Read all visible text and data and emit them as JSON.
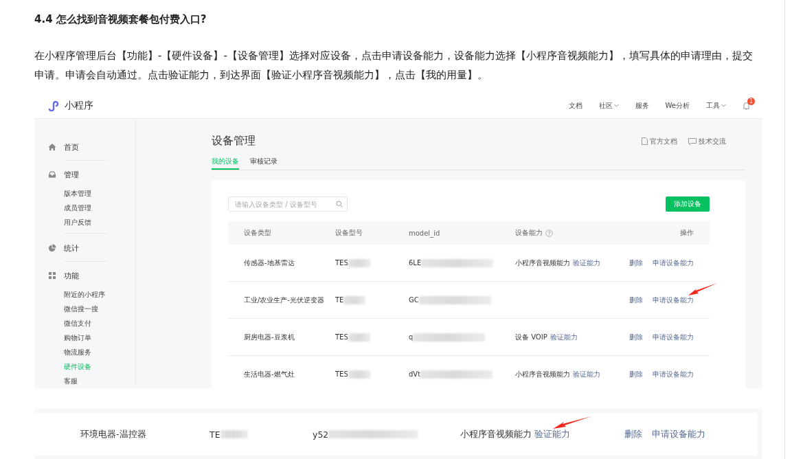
{
  "article": {
    "heading": "4.4 怎么找到音视频套餐包付费入口?",
    "paragraph": "在小程序管理后台【功能】-【硬件设备】-【设备管理】选择对应设备，点击申请设备能力，设备能力选择【小程序音视频能力】，填写具体的申请理由，提交申请。申请会自动通过。点击验证能力，到达界面【验证小程序音视频能力】，点击【我的用量】。"
  },
  "screenshot_1": {
    "topbar": {
      "logo_text": "小程序",
      "nav": [
        {
          "label": "文档",
          "dropdown": false
        },
        {
          "label": "社区",
          "dropdown": true
        },
        {
          "label": "服务",
          "dropdown": false
        },
        {
          "label": "We分析",
          "dropdown": false
        },
        {
          "label": "工具",
          "dropdown": true
        }
      ],
      "notification_badge": "1"
    },
    "sidebar": [
      {
        "label": "首页"
      },
      {
        "label": "管理",
        "children": [
          {
            "label": "版本管理",
            "selected": false
          },
          {
            "label": "成员管理",
            "selected": false
          },
          {
            "label": "用户反馈",
            "selected": false
          }
        ]
      },
      {
        "label": "统计"
      },
      {
        "label": "功能",
        "children": [
          {
            "label": "附近的小程序",
            "selected": false
          },
          {
            "label": "微信搜一搜",
            "selected": false
          },
          {
            "label": "微信支付",
            "selected": false
          },
          {
            "label": "购物订单",
            "selected": false
          },
          {
            "label": "物流服务",
            "selected": false
          },
          {
            "label": "硬件设备",
            "selected": true
          },
          {
            "label": "客服",
            "selected": false
          }
        ]
      }
    ],
    "page_title": "设备管理",
    "doc_links": [
      {
        "label": "官方文档"
      },
      {
        "label": "技术交流"
      }
    ],
    "tabs": [
      {
        "label": "我的设备",
        "selected": true
      },
      {
        "label": "审核记录",
        "selected": false
      }
    ],
    "search": {
      "placeholder": "请输入设备类型 / 设备型号"
    },
    "add_button": "添加设备",
    "columns": [
      "设备类型",
      "设备型号",
      "model_id",
      "设备能力",
      "操作"
    ],
    "rows": [
      {
        "type": "传感器-地基雷达",
        "model": "TES",
        "model_id": "6LE",
        "capability": "小程序音视频能力",
        "verify": "验证能力",
        "actions": [
          "删除",
          "申请设备能力"
        ]
      },
      {
        "type": "工业/农业生产-光伏逆变器",
        "model": "TE",
        "model_id": "GC",
        "actions": [
          "删除",
          "申请设备能力"
        ],
        "arrow": true
      },
      {
        "type": "厨房电器-豆浆机",
        "model": "TES",
        "model_id": "q",
        "capability": "设备 VOIP",
        "verify": "验证能力",
        "actions": [
          "删除",
          "申请设备能力"
        ]
      },
      {
        "type": "生活电器-燃气灶",
        "model": "TES",
        "model_id": "dVt",
        "capability": "小程序音视频能力",
        "verify": "验证能力",
        "actions": [
          "删除",
          "申请设备能力"
        ]
      }
    ]
  },
  "screenshot_2": {
    "rows": [
      {
        "type": "环境电器-温控器",
        "model": "TE",
        "model_id": "y52",
        "capability": "小程序音视频能力",
        "verify": "验证能力",
        "actions": [
          "删除",
          "申请设备能力"
        ],
        "arrow": true
      }
    ]
  }
}
